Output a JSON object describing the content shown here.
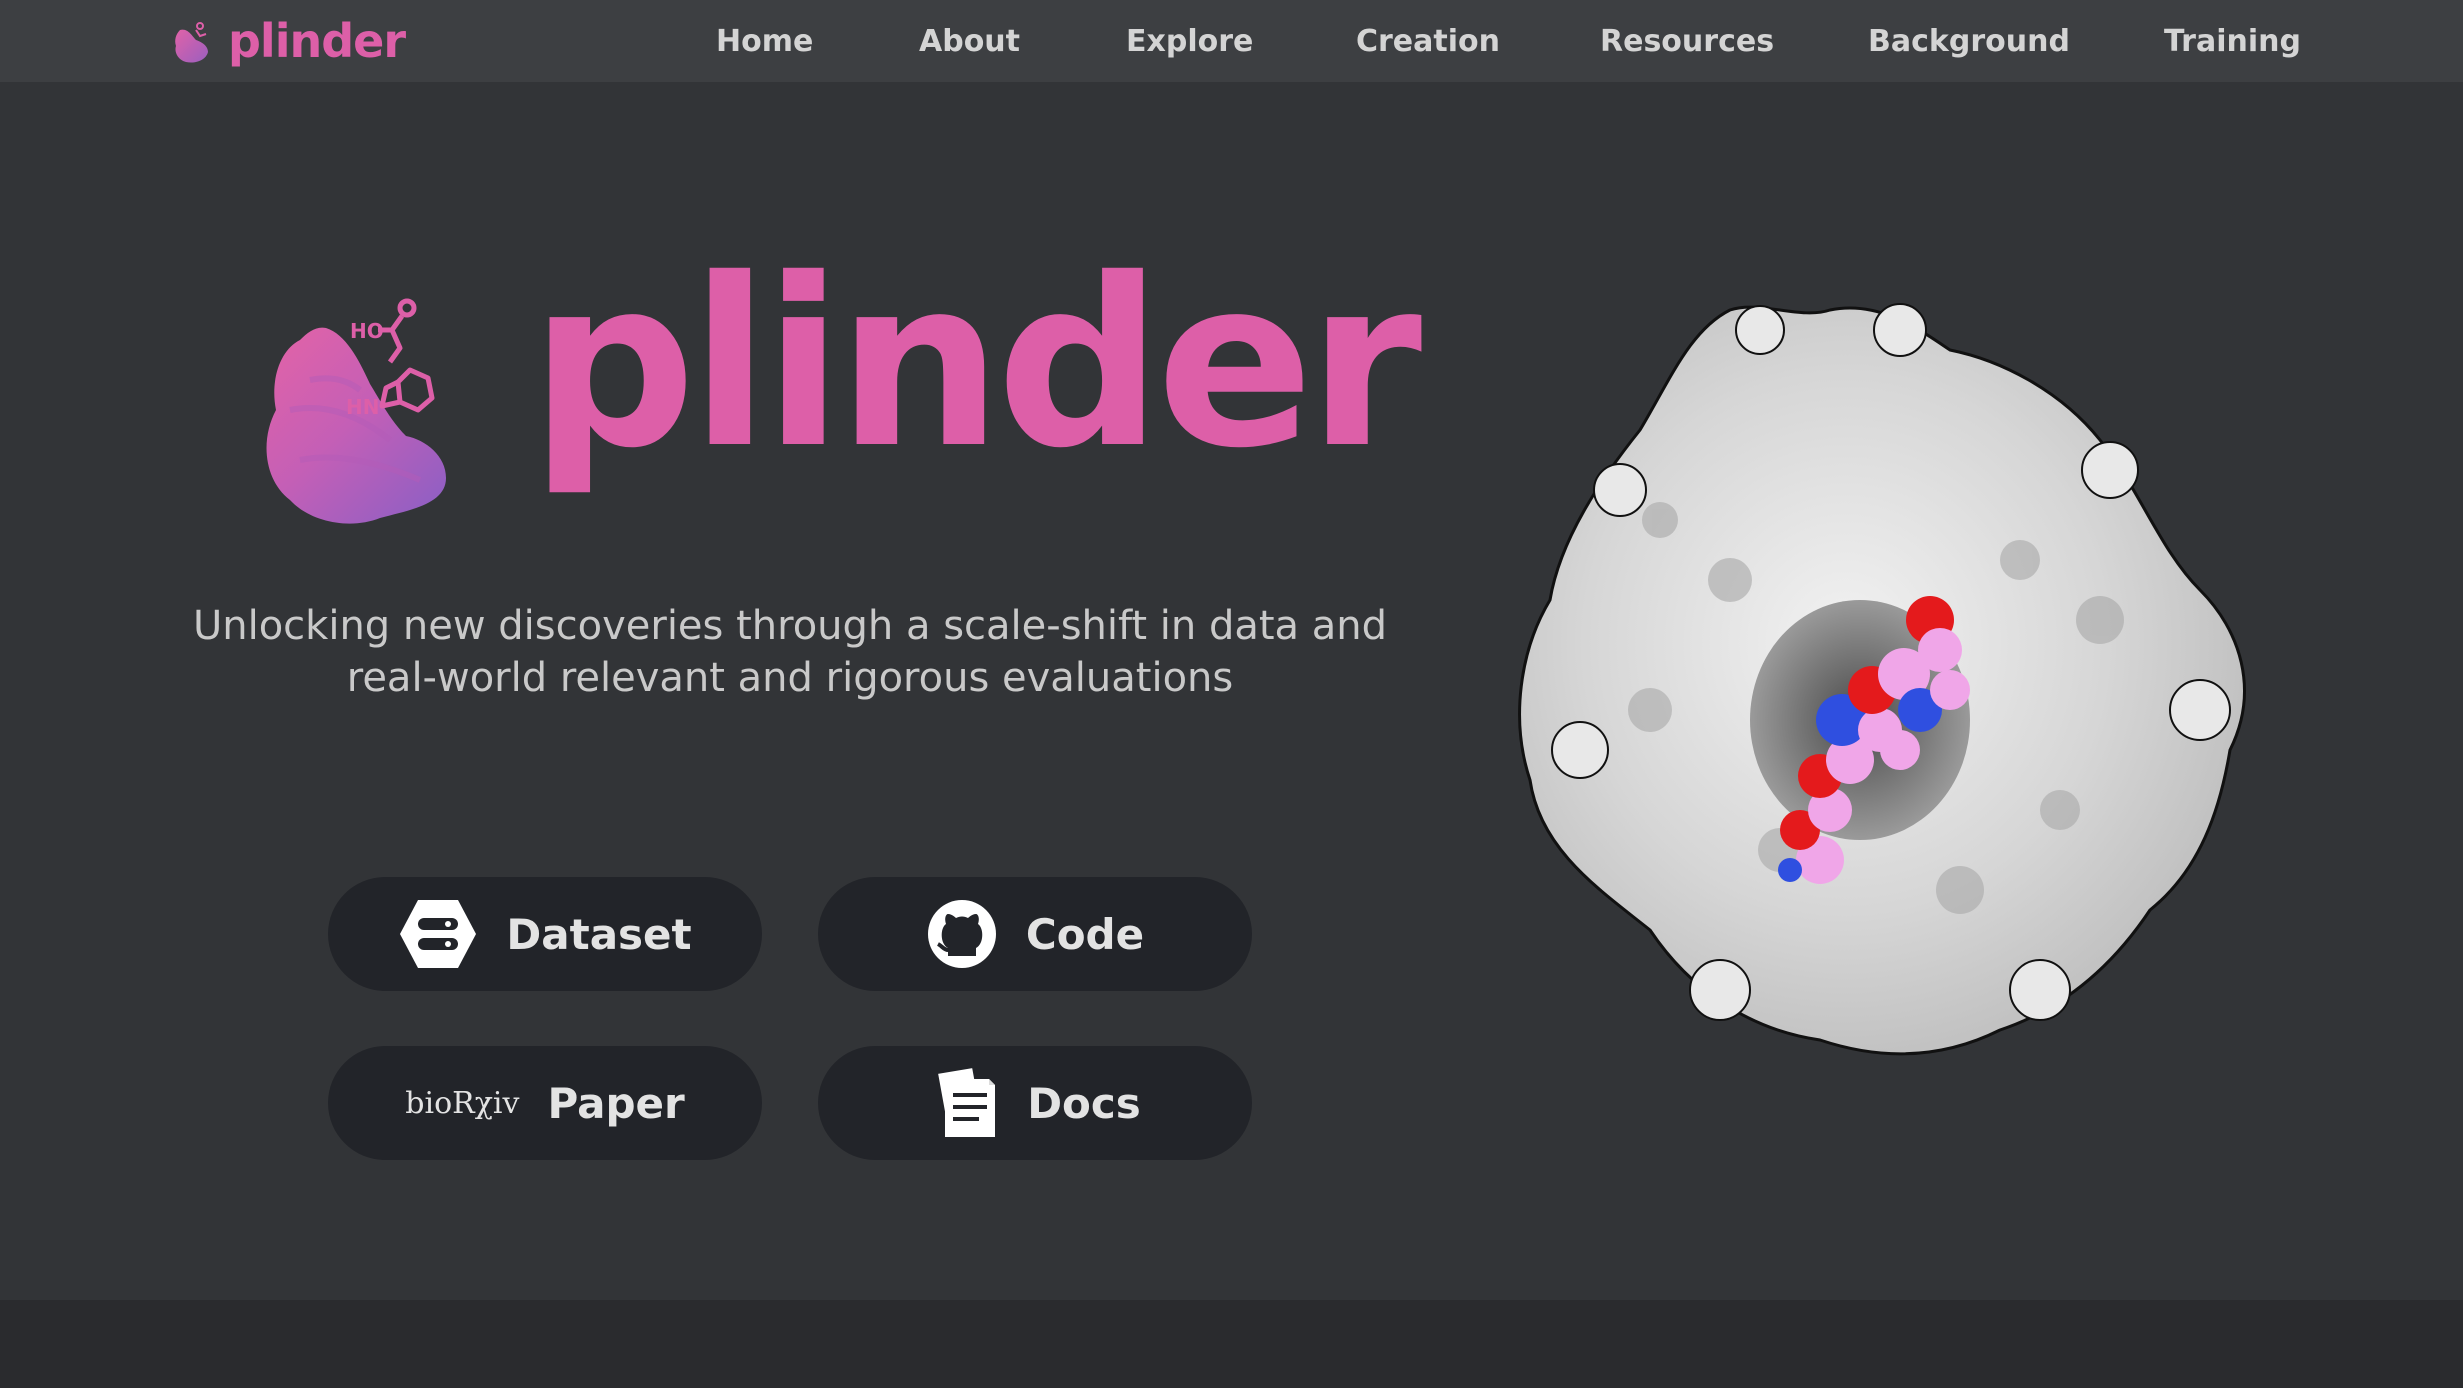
{
  "nav": {
    "brand": "plinder",
    "links": [
      "Home",
      "About",
      "Explore",
      "Creation",
      "Resources",
      "Background",
      "Training"
    ]
  },
  "hero": {
    "title": "plinder",
    "tagline_line1": "Unlocking new discoveries through a scale-shift in data and",
    "tagline_line2": "real-world relevant and rigorous evaluations"
  },
  "buttons": {
    "dataset": "Dataset",
    "code": "Code",
    "paper_prefix": "bioRχiv",
    "paper": "Paper",
    "docs": "Docs"
  },
  "colors": {
    "brand": "#dd5fa8",
    "navbar": "#3d3f42",
    "background": "#323437",
    "button": "#222429"
  },
  "icons": {
    "brand_logo": "plinder-logo-icon",
    "dataset": "database-icon",
    "code": "github-icon",
    "docs": "document-icon"
  }
}
